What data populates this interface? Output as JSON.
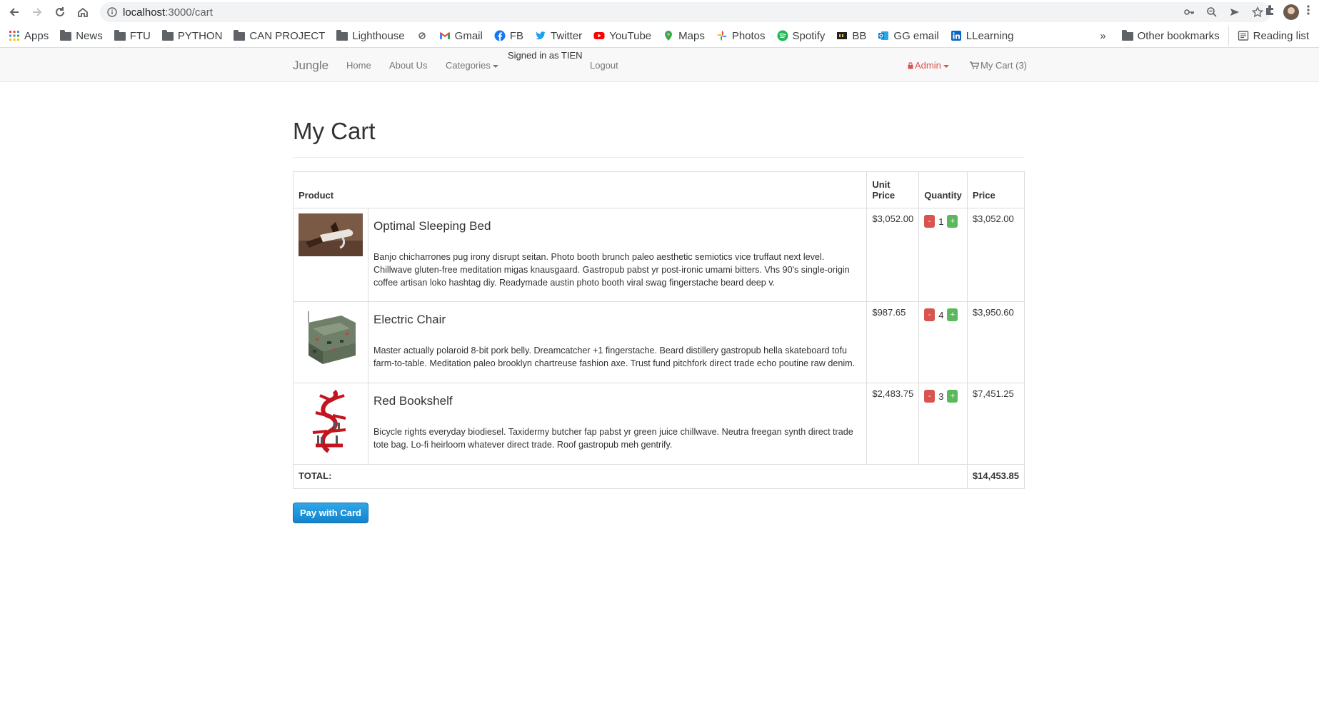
{
  "browser": {
    "url_host": "localhost",
    "url_path": ":3000/cart",
    "bookmarks": [
      "Apps",
      "News",
      "FTU",
      "PYTHON",
      "CAN PROJECT",
      "Lighthouse",
      "Gmail",
      "FB",
      "Twitter",
      "YouTube",
      "Maps",
      "Photos",
      "Spotify",
      "BB",
      "GG email",
      "LLearning"
    ],
    "overflow": "»",
    "other_bookmarks": "Other bookmarks",
    "reading_list": "Reading list"
  },
  "nav": {
    "brand": "Jungle",
    "home": "Home",
    "about": "About Us",
    "categories": "Categories",
    "signed_in": "Signed in as TIEN",
    "logout": "Logout",
    "admin": "Admin",
    "cart": "My Cart (3)"
  },
  "page": {
    "title": "My Cart"
  },
  "table": {
    "headers": {
      "product": "Product",
      "unit_price_1": "Unit",
      "unit_price_2": "Price",
      "quantity": "Quantity",
      "price": "Price"
    },
    "items": [
      {
        "name": "Optimal Sleeping Bed",
        "description": "Banjo chicharrones pug irony disrupt seitan. Photo booth brunch paleo aesthetic semiotics vice truffaut next level. Chillwave gluten-free meditation migas knausgaard. Gastropub pabst yr post-ironic umami bitters. Vhs 90's single-origin coffee artisan loko hashtag diy. Readymade austin photo booth viral swag fingerstache beard deep v.",
        "unit_price": "$3,052.00",
        "quantity": "1",
        "price": "$3,052.00"
      },
      {
        "name": "Electric Chair",
        "description": "Master actually polaroid 8-bit pork belly. Dreamcatcher +1 fingerstache. Beard distillery gastropub hella skateboard tofu farm-to-table. Meditation paleo brooklyn chartreuse fashion axe. Trust fund pitchfork direct trade echo poutine raw denim.",
        "unit_price": "$987.65",
        "quantity": "4",
        "price": "$3,950.60"
      },
      {
        "name": "Red Bookshelf",
        "description": "Bicycle rights everyday biodiesel. Taxidermy butcher fap pabst yr green juice chillwave. Neutra freegan synth direct trade tote bag. Lo-fi heirloom whatever direct trade. Roof gastropub meh gentrify.",
        "unit_price": "$2,483.75",
        "quantity": "3",
        "price": "$7,451.25"
      }
    ],
    "minus": "-",
    "plus": "+",
    "total_label": "TOTAL:",
    "total_value": "$14,453.85"
  },
  "pay_button": "Pay with Card",
  "colors": {
    "minus": "#d9534f",
    "plus": "#5cb85c",
    "pay": "#1e96dc",
    "admin": "#d9534f"
  }
}
